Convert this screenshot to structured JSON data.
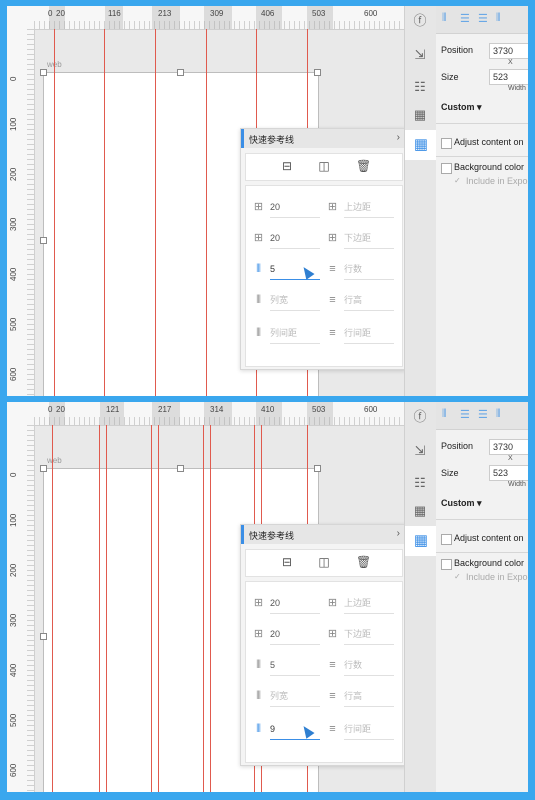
{
  "ruler": {
    "panel1_labels": [
      "0",
      "20",
      "116",
      "213",
      "309",
      "406",
      "503",
      "600"
    ],
    "panel2_labels": [
      "0",
      "20",
      "121",
      "217",
      "314",
      "410",
      "503",
      "600"
    ],
    "vertical_labels": [
      "0",
      "100",
      "200",
      "300",
      "400",
      "500",
      "600"
    ]
  },
  "canvas": {
    "artboard_name": "web"
  },
  "popup": {
    "title": "快速参考线",
    "chevron": "›",
    "tools": [
      "horizontal-split-icon",
      "vertical-split-icon",
      "trash-icon"
    ],
    "panel1": {
      "col_gutter_left": "20",
      "top_margin_placeholder": "上边距",
      "col_gutter_right": "20",
      "bottom_margin_placeholder": "下边距",
      "columns": "5",
      "rows_placeholder": "行数",
      "col_width_placeholder": "列宽",
      "row_height_placeholder": "行高",
      "col_spacing_placeholder": "列间距",
      "row_spacing_placeholder": "行间距"
    },
    "panel2": {
      "col_gutter_left": "20",
      "top_margin_placeholder": "上边距",
      "col_gutter_right": "20",
      "bottom_margin_placeholder": "下边距",
      "columns": "5",
      "rows_placeholder": "行数",
      "col_width_placeholder": "列宽",
      "row_height_placeholder": "行高",
      "col_spacing": "9",
      "row_spacing_placeholder": "行间距"
    }
  },
  "inspector": {
    "position_label": "Position",
    "position_x": "3730",
    "x_label": "X",
    "size_label": "Size",
    "size_width": "523",
    "width_label": "Width",
    "custom_label": "Custom ▾",
    "adjust_content": "Adjust content on",
    "background_color": "Background color",
    "include_export": "Include in Expo"
  },
  "colors": {
    "guide": "#e05a4e",
    "accent": "#3a8ee6",
    "frame": "#3aa7ee"
  }
}
